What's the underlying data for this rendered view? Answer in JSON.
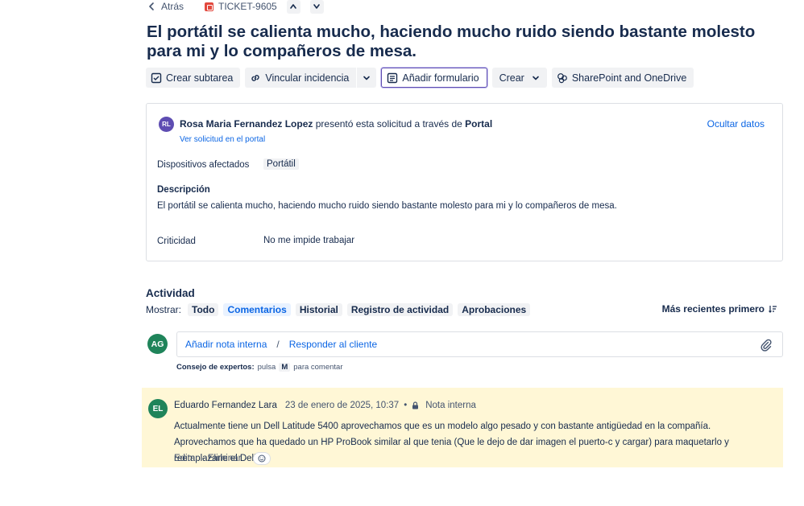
{
  "topbar": {
    "back_label": "Atrás",
    "ticket_id": "TICKET-9605"
  },
  "title": "El portátil se calienta mucho, haciendo mucho ruido siendo bastante molesto para mi y lo compañeros de mesa.",
  "toolbar": {
    "create_subtask": "Crear subtarea",
    "link_issue": "Vincular incidencia",
    "add_form": "Añadir formulario",
    "create": "Crear",
    "sharepoint": "SharePoint and OneDrive"
  },
  "request": {
    "avatar_initials": "RL",
    "requester": "Rosa Maria Fernandez Lopez",
    "via_text": "presentó esta solicitud a través de",
    "channel": "Portal",
    "view_link": "Ver solicitud en el portal",
    "hide_data": "Ocultar datos",
    "fields": {
      "devices_label": "Dispositivos afectados",
      "devices_value": "Portátil",
      "description_label": "Descripción",
      "description_value": "El portátil se calienta mucho, haciendo mucho ruido siendo bastante molesto para mi y lo compañeros de mesa.",
      "criticality_label": "Criticidad",
      "criticality_value": "No me impide trabajar"
    }
  },
  "activity": {
    "title": "Actividad",
    "show_label": "Mostrar:",
    "filters": [
      "Todo",
      "Comentarios",
      "Historial",
      "Registro de actividad",
      "Aprobaciones"
    ],
    "sort_label": "Más recientes primero",
    "composer": {
      "avatar_initials": "AG",
      "internal_note": "Añadir nota interna",
      "separator": "/",
      "reply_customer": "Responder al cliente",
      "tip_bold": "Consejo de expertos:",
      "tip_press": "pulsa",
      "tip_key": "M",
      "tip_rest": "para comentar"
    },
    "note": {
      "avatar_initials": "EL",
      "author": "Eduardo Fernandez Lara",
      "date": "23 de enero de 2025, 10:37",
      "dot": "•",
      "badge": "Nota interna",
      "body": "Actualmente tiene un Dell Latitude 5400 aprovechamos que es un modelo algo pesado y con bastante antigüedad en la compañía. Aprovechamos que ha quedado un HP ProBook similar al que tenia (Que le dejo de dar imagen el puerto-c y cargar) para maquetarlo y reemplazarle el Dell.",
      "edit": "Editar",
      "delete": "Eliminar",
      "action_sep": "·"
    }
  },
  "colors": {
    "link": "#0c66e4",
    "note_bg": "#fff7d6",
    "avatar_green": "#1f845a",
    "avatar_purple": "#5e4db2",
    "ticket_red": "#e2483d"
  }
}
